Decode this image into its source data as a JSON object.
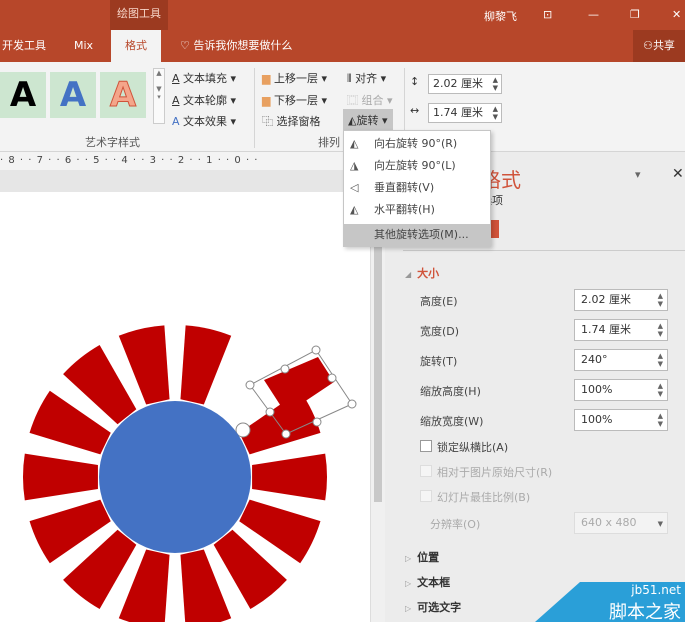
{
  "titlebar": {
    "context_tab": "绘图工具",
    "user": "柳黎飞",
    "share": "共享"
  },
  "tabs": [
    {
      "label": "开发工具"
    },
    {
      "label": "Mix"
    },
    {
      "label": "格式"
    }
  ],
  "tell_me": "告诉我你想要做什么",
  "ribbon": {
    "wordart_letter": "A",
    "text_fill": "文本填充",
    "text_outline": "文本轮廓",
    "text_effects": "文本效果",
    "group_wordart": "艺术字样式",
    "bring_forward": "上移一层",
    "send_backward": "下移一层",
    "selection_pane": "选择窗格",
    "align": "对齐",
    "group": "组合",
    "rotate": "旋转",
    "group_arrange": "排列",
    "height": "2.02 厘米",
    "width": "1.74 厘米"
  },
  "ruler": "· 8 · · 7 · · 6 · · 5 · · 4 · · 3 · · 2 · · 1 · · 0 · ·",
  "rotate_menu": [
    {
      "label": "向右旋转 90°(R)",
      "icon": "rotate-right-icon"
    },
    {
      "label": "向左旋转 90°(L)",
      "icon": "rotate-left-icon"
    },
    {
      "label": "垂直翻转(V)",
      "icon": "flip-vertical-icon"
    },
    {
      "label": "水平翻转(H)",
      "icon": "flip-horizontal-icon"
    },
    {
      "label": "其他旋转选项(M)..."
    }
  ],
  "pane": {
    "title": "格式",
    "subtitle": "选项",
    "size_section": "大小",
    "fields": [
      {
        "label": "高度(E)",
        "value": "2.02 厘米"
      },
      {
        "label": "宽度(D)",
        "value": "1.74 厘米"
      },
      {
        "label": "旋转(T)",
        "value": "240°"
      },
      {
        "label": "缩放高度(H)",
        "value": "100%"
      },
      {
        "label": "缩放宽度(W)",
        "value": "100%"
      }
    ],
    "lock_aspect": "锁定纵横比(A)",
    "relative_original": "相对于图片原始尺寸(R)",
    "best_scale": "幻灯片最佳比例(B)",
    "resolution_label": "分辨率(O)",
    "resolution_value": "640 x 480",
    "sections": [
      "位置",
      "文本框",
      "可选文字"
    ]
  },
  "watermark": {
    "url": "jb51.net",
    "name": "脚本之家"
  },
  "colors": {
    "brand": "#b7472a",
    "petal": "#c00000",
    "center": "#4472c4"
  }
}
